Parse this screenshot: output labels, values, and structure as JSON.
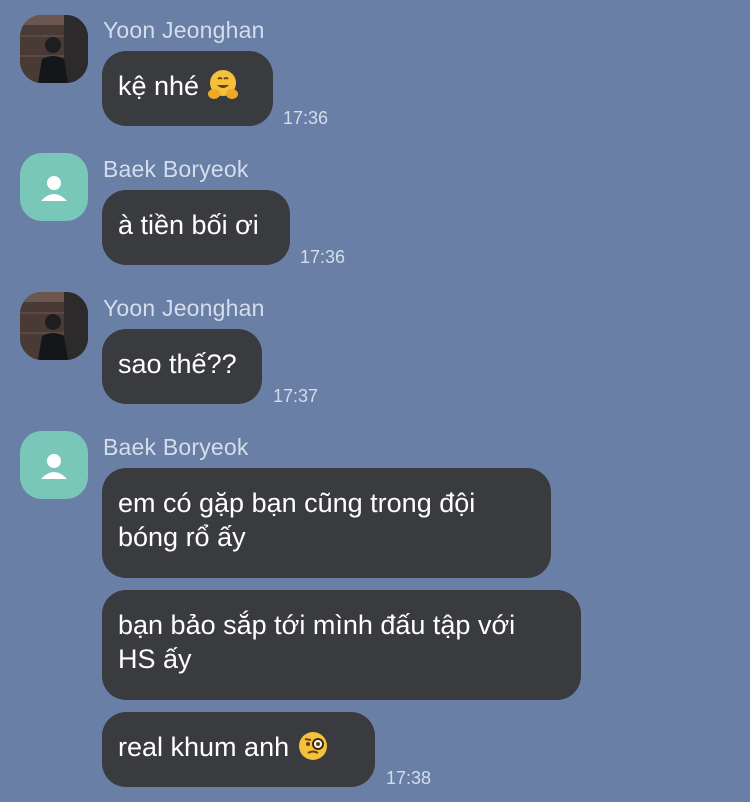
{
  "messages": [
    {
      "sender": "Yoon Jeonghan",
      "avatar": "photo-avatar-icon",
      "text": "kệ nhé",
      "emoji": "hugging-face-icon",
      "time": "17:36"
    },
    {
      "sender": "Baek Boryeok",
      "avatar": "default-person-avatar-icon",
      "text": "à tiền bối ơi",
      "time": "17:36"
    },
    {
      "sender": "Yoon Jeonghan",
      "avatar": "photo-avatar-icon",
      "text": "sao thế??",
      "time": "17:37"
    },
    {
      "sender": "Baek Boryeok",
      "avatar": "default-person-avatar-icon",
      "bubbles": [
        {
          "lines": [
            "em có gặp bạn cũng trong đội",
            "bóng rổ ấy"
          ]
        },
        {
          "lines": [
            "bạn bảo sắp tới mình đấu tập với",
            "HS ấy"
          ]
        },
        {
          "text": "real khum anh",
          "emoji": "face-with-monocle-icon"
        }
      ],
      "time": "17:38"
    }
  ],
  "colors": {
    "background": "#6a7fa6",
    "bubble": "#3a3b3e",
    "avatar_default": "#79c7b9"
  }
}
